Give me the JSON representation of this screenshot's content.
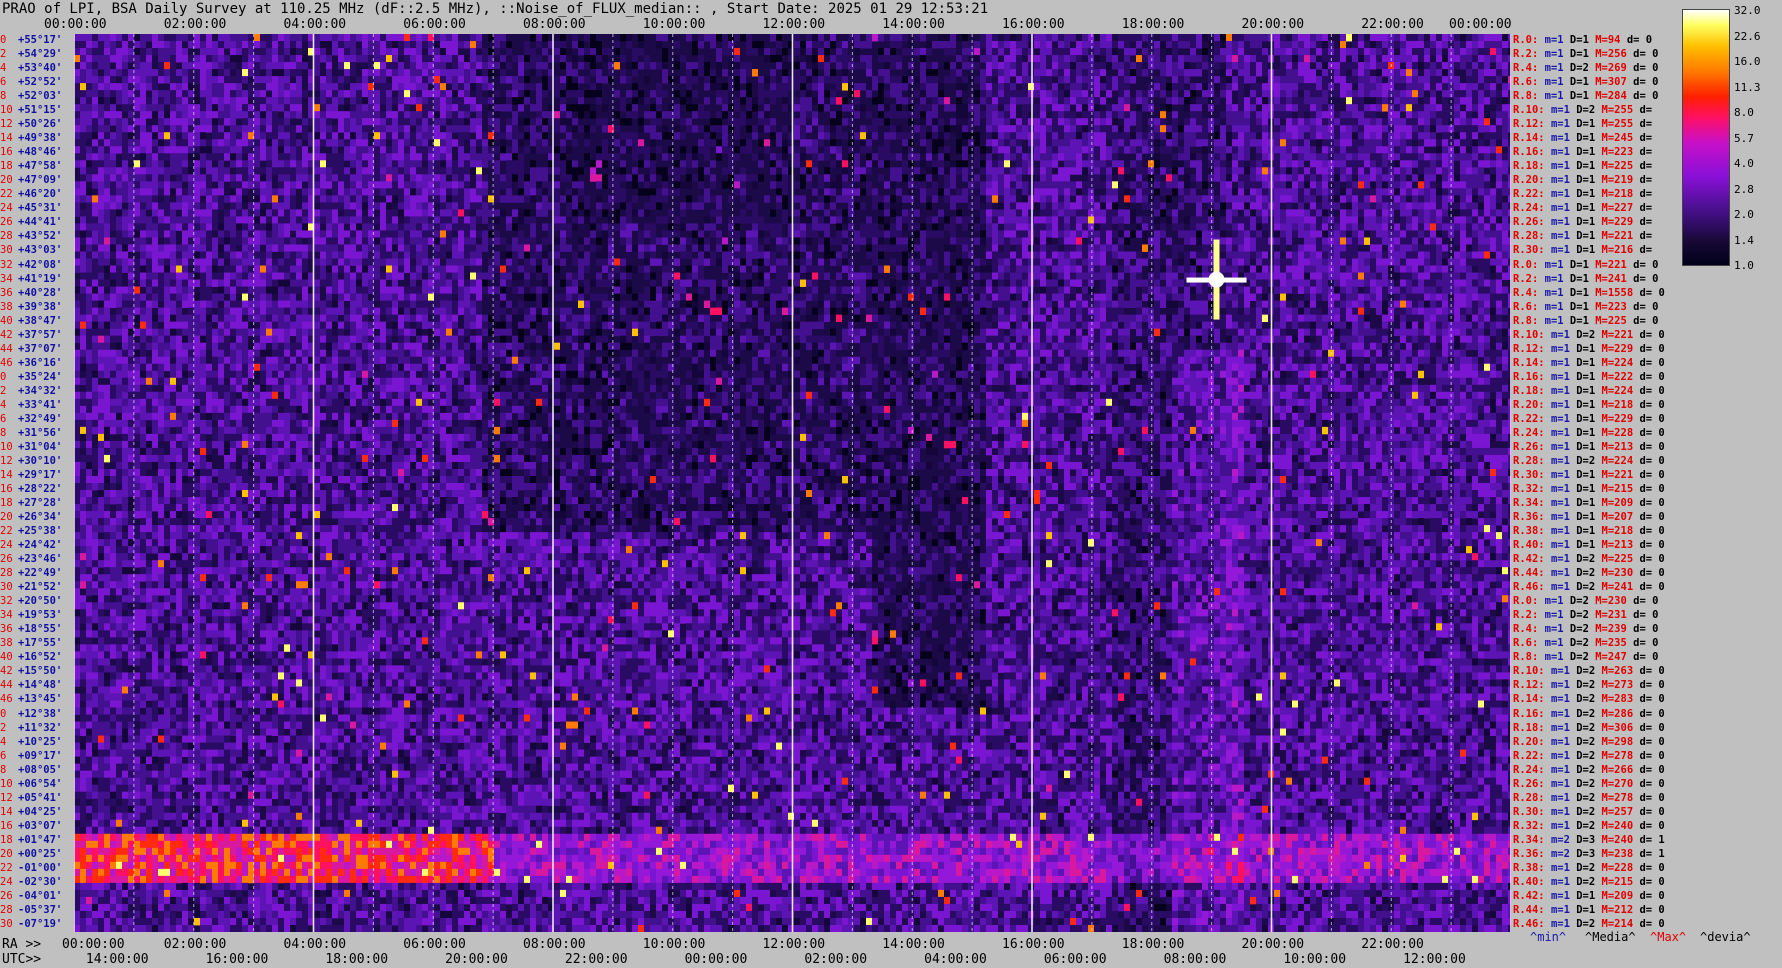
{
  "title": "PRAO of LPI, BSA Daily Survey at 110.25 MHz (dF::2.5 MHz), ::Noise_of_FLUX_median:: , Start Date: 2025 01 29 12:53:21",
  "top_axis": [
    "00:00:00",
    "02:00:00",
    "04:00:00",
    "06:00:00",
    "08:00:00",
    "10:00:00",
    "12:00:00",
    "14:00:00",
    "16:00:00",
    "18:00:00",
    "20:00:00",
    "22:00:00",
    "00:00:00"
  ],
  "ra_label": "RA >>",
  "ra_axis": [
    "00:00:00",
    "02:00:00",
    "04:00:00",
    "06:00:00",
    "08:00:00",
    "10:00:00",
    "12:00:00",
    "14:00:00",
    "16:00:00",
    "18:00:00",
    "20:00:00",
    "22:00:00"
  ],
  "utc_label": "UTC>>",
  "utc_axis": [
    "14:00:00",
    "16:00:00",
    "18:00:00",
    "20:00:00",
    "22:00:00",
    "00:00:00",
    "02:00:00",
    "04:00:00",
    "06:00:00",
    "08:00:00",
    "10:00:00",
    "12:00:00"
  ],
  "left_rows": [
    {
      "n": "0",
      "dec": "+55°17'"
    },
    {
      "n": "2",
      "dec": "+54°29'"
    },
    {
      "n": "4",
      "dec": "+53°40'"
    },
    {
      "n": "6",
      "dec": "+52°52'"
    },
    {
      "n": "8",
      "dec": "+52°03'"
    },
    {
      "n": "10",
      "dec": "+51°15'"
    },
    {
      "n": "12",
      "dec": "+50°26'"
    },
    {
      "n": "14",
      "dec": "+49°38'"
    },
    {
      "n": "16",
      "dec": "+48°46'"
    },
    {
      "n": "18",
      "dec": "+47°58'"
    },
    {
      "n": "20",
      "dec": "+47°09'"
    },
    {
      "n": "22",
      "dec": "+46°20'"
    },
    {
      "n": "24",
      "dec": "+45°31'"
    },
    {
      "n": "26",
      "dec": "+44°41'"
    },
    {
      "n": "28",
      "dec": "+43°52'"
    },
    {
      "n": "30",
      "dec": "+43°03'"
    },
    {
      "n": "32",
      "dec": "+42°08'"
    },
    {
      "n": "34",
      "dec": "+41°19'"
    },
    {
      "n": "36",
      "dec": "+40°28'"
    },
    {
      "n": "38",
      "dec": "+39°38'"
    },
    {
      "n": "40",
      "dec": "+38°47'"
    },
    {
      "n": "42",
      "dec": "+37°57'"
    },
    {
      "n": "44",
      "dec": "+37°07'"
    },
    {
      "n": "46",
      "dec": "+36°16'"
    },
    {
      "n": "0",
      "dec": "+35°24'"
    },
    {
      "n": "2",
      "dec": "+34°32'"
    },
    {
      "n": "4",
      "dec": "+33°41'"
    },
    {
      "n": "6",
      "dec": "+32°49'"
    },
    {
      "n": "8",
      "dec": "+31°56'"
    },
    {
      "n": "10",
      "dec": "+31°04'"
    },
    {
      "n": "12",
      "dec": "+30°10'"
    },
    {
      "n": "14",
      "dec": "+29°17'"
    },
    {
      "n": "16",
      "dec": "+28°22'"
    },
    {
      "n": "18",
      "dec": "+27°28'"
    },
    {
      "n": "20",
      "dec": "+26°34'"
    },
    {
      "n": "22",
      "dec": "+25°38'"
    },
    {
      "n": "24",
      "dec": "+24°42'"
    },
    {
      "n": "26",
      "dec": "+23°46'"
    },
    {
      "n": "28",
      "dec": "+22°49'"
    },
    {
      "n": "30",
      "dec": "+21°52'"
    },
    {
      "n": "32",
      "dec": "+20°50'"
    },
    {
      "n": "34",
      "dec": "+19°53'"
    },
    {
      "n": "36",
      "dec": "+18°55'"
    },
    {
      "n": "38",
      "dec": "+17°55'"
    },
    {
      "n": "40",
      "dec": "+16°52'"
    },
    {
      "n": "42",
      "dec": "+15°50'"
    },
    {
      "n": "44",
      "dec": "+14°48'"
    },
    {
      "n": "46",
      "dec": "+13°45'"
    },
    {
      "n": "0",
      "dec": "+12°38'"
    },
    {
      "n": "2",
      "dec": "+11°32'"
    },
    {
      "n": "4",
      "dec": "+10°25'"
    },
    {
      "n": "6",
      "dec": "+09°17'"
    },
    {
      "n": "8",
      "dec": "+08°05'"
    },
    {
      "n": "10",
      "dec": "+06°54'"
    },
    {
      "n": "12",
      "dec": "+05°41'"
    },
    {
      "n": "14",
      "dec": "+04°25'"
    },
    {
      "n": "16",
      "dec": "+03°07'"
    },
    {
      "n": "18",
      "dec": "+01°47'"
    },
    {
      "n": "20",
      "dec": "+00°25'"
    },
    {
      "n": "22",
      "dec": "-01°00'"
    },
    {
      "n": "24",
      "dec": "-02°30'"
    },
    {
      "n": "26",
      "dec": "-04°01'"
    },
    {
      "n": "28",
      "dec": "-05°37'"
    },
    {
      "n": "30",
      "dec": "-07°19'"
    }
  ],
  "right_rows": [
    {
      "r": "R.0:",
      "m": "m=1",
      "d": "D=1",
      "h": "M=94",
      "dv": "d= 0"
    },
    {
      "r": "R.2:",
      "m": "m=1",
      "d": "D=1",
      "h": "M=256",
      "dv": "d= 0"
    },
    {
      "r": "R.4:",
      "m": "m=1",
      "d": "D=2",
      "h": "M=269",
      "dv": "d= 0"
    },
    {
      "r": "R.6:",
      "m": "m=1",
      "d": "D=1",
      "h": "M=307",
      "dv": "d= 0"
    },
    {
      "r": "R.8:",
      "m": "m=1",
      "d": "D=1",
      "h": "M=284",
      "dv": "d= 0"
    },
    {
      "r": "R.10:",
      "m": "m=1",
      "d": "D=2",
      "h": "M=255",
      "dv": "d="
    },
    {
      "r": "R.12:",
      "m": "m=1",
      "d": "D=1",
      "h": "M=255",
      "dv": "d="
    },
    {
      "r": "R.14:",
      "m": "m=1",
      "d": "D=1",
      "h": "M=245",
      "dv": "d="
    },
    {
      "r": "R.16:",
      "m": "m=1",
      "d": "D=1",
      "h": "M=223",
      "dv": "d="
    },
    {
      "r": "R.18:",
      "m": "m=1",
      "d": "D=1",
      "h": "M=225",
      "dv": "d="
    },
    {
      "r": "R.20:",
      "m": "m=1",
      "d": "D=1",
      "h": "M=219",
      "dv": "d="
    },
    {
      "r": "R.22:",
      "m": "m=1",
      "d": "D=1",
      "h": "M=218",
      "dv": "d="
    },
    {
      "r": "R.24:",
      "m": "m=1",
      "d": "D=1",
      "h": "M=227",
      "dv": "d="
    },
    {
      "r": "R.26:",
      "m": "m=1",
      "d": "D=1",
      "h": "M=229",
      "dv": "d="
    },
    {
      "r": "R.28:",
      "m": "m=1",
      "d": "D=1",
      "h": "M=221",
      "dv": "d="
    },
    {
      "r": "R.30:",
      "m": "m=1",
      "d": "D=1",
      "h": "M=216",
      "dv": "d="
    },
    {
      "r": "R.0:",
      "m": "m=1",
      "d": "D=1",
      "h": "M=221",
      "dv": "d= 0"
    },
    {
      "r": "R.2:",
      "m": "m=1",
      "d": "D=1",
      "h": "M=241",
      "dv": "d= 0"
    },
    {
      "r": "R.4:",
      "m": "m=1",
      "d": "D=1",
      "h": "M=1558",
      "dv": "d= 0"
    },
    {
      "r": "R.6:",
      "m": "m=1",
      "d": "D=1",
      "h": "M=223",
      "dv": "d= 0"
    },
    {
      "r": "R.8:",
      "m": "m=1",
      "d": "D=1",
      "h": "M=225",
      "dv": "d= 0"
    },
    {
      "r": "R.10:",
      "m": "m=1",
      "d": "D=2",
      "h": "M=221",
      "dv": "d= 0"
    },
    {
      "r": "R.12:",
      "m": "m=1",
      "d": "D=1",
      "h": "M=229",
      "dv": "d= 0"
    },
    {
      "r": "R.14:",
      "m": "m=1",
      "d": "D=1",
      "h": "M=224",
      "dv": "d= 0"
    },
    {
      "r": "R.16:",
      "m": "m=1",
      "d": "D=1",
      "h": "M=222",
      "dv": "d= 0"
    },
    {
      "r": "R.18:",
      "m": "m=1",
      "d": "D=1",
      "h": "M=224",
      "dv": "d= 0"
    },
    {
      "r": "R.20:",
      "m": "m=1",
      "d": "D=1",
      "h": "M=218",
      "dv": "d= 0"
    },
    {
      "r": "R.22:",
      "m": "m=1",
      "d": "D=1",
      "h": "M=229",
      "dv": "d= 0"
    },
    {
      "r": "R.24:",
      "m": "m=1",
      "d": "D=1",
      "h": "M=228",
      "dv": "d= 0"
    },
    {
      "r": "R.26:",
      "m": "m=1",
      "d": "D=1",
      "h": "M=213",
      "dv": "d= 0"
    },
    {
      "r": "R.28:",
      "m": "m=1",
      "d": "D=2",
      "h": "M=224",
      "dv": "d= 0"
    },
    {
      "r": "R.30:",
      "m": "m=1",
      "d": "D=1",
      "h": "M=221",
      "dv": "d= 0"
    },
    {
      "r": "R.32:",
      "m": "m=1",
      "d": "D=1",
      "h": "M=215",
      "dv": "d= 0"
    },
    {
      "r": "R.34:",
      "m": "m=1",
      "d": "D=1",
      "h": "M=209",
      "dv": "d= 0"
    },
    {
      "r": "R.36:",
      "m": "m=1",
      "d": "D=1",
      "h": "M=207",
      "dv": "d= 0"
    },
    {
      "r": "R.38:",
      "m": "m=1",
      "d": "D=1",
      "h": "M=218",
      "dv": "d= 0"
    },
    {
      "r": "R.40:",
      "m": "m=1",
      "d": "D=1",
      "h": "M=213",
      "dv": "d= 0"
    },
    {
      "r": "R.42:",
      "m": "m=1",
      "d": "D=2",
      "h": "M=225",
      "dv": "d= 0"
    },
    {
      "r": "R.44:",
      "m": "m=1",
      "d": "D=2",
      "h": "M=230",
      "dv": "d= 0"
    },
    {
      "r": "R.46:",
      "m": "m=1",
      "d": "D=2",
      "h": "M=241",
      "dv": "d= 0"
    },
    {
      "r": "R.0:",
      "m": "m=1",
      "d": "D=2",
      "h": "M=230",
      "dv": "d= 0"
    },
    {
      "r": "R.2:",
      "m": "m=1",
      "d": "D=2",
      "h": "M=231",
      "dv": "d= 0"
    },
    {
      "r": "R.4:",
      "m": "m=1",
      "d": "D=2",
      "h": "M=239",
      "dv": "d= 0"
    },
    {
      "r": "R.6:",
      "m": "m=1",
      "d": "D=2",
      "h": "M=235",
      "dv": "d= 0"
    },
    {
      "r": "R.8:",
      "m": "m=1",
      "d": "D=2",
      "h": "M=247",
      "dv": "d= 0"
    },
    {
      "r": "R.10:",
      "m": "m=1",
      "d": "D=2",
      "h": "M=263",
      "dv": "d= 0"
    },
    {
      "r": "R.12:",
      "m": "m=1",
      "d": "D=2",
      "h": "M=273",
      "dv": "d= 0"
    },
    {
      "r": "R.14:",
      "m": "m=1",
      "d": "D=2",
      "h": "M=283",
      "dv": "d= 0"
    },
    {
      "r": "R.16:",
      "m": "m=1",
      "d": "D=2",
      "h": "M=286",
      "dv": "d= 0"
    },
    {
      "r": "R.18:",
      "m": "m=1",
      "d": "D=2",
      "h": "M=306",
      "dv": "d= 0"
    },
    {
      "r": "R.20:",
      "m": "m=1",
      "d": "D=2",
      "h": "M=298",
      "dv": "d= 0"
    },
    {
      "r": "R.22:",
      "m": "m=1",
      "d": "D=2",
      "h": "M=278",
      "dv": "d= 0"
    },
    {
      "r": "R.24:",
      "m": "m=1",
      "d": "D=2",
      "h": "M=266",
      "dv": "d= 0"
    },
    {
      "r": "R.26:",
      "m": "m=1",
      "d": "D=2",
      "h": "M=270",
      "dv": "d= 0"
    },
    {
      "r": "R.28:",
      "m": "m=1",
      "d": "D=2",
      "h": "M=278",
      "dv": "d= 0"
    },
    {
      "r": "R.30:",
      "m": "m=1",
      "d": "D=2",
      "h": "M=257",
      "dv": "d= 0"
    },
    {
      "r": "R.32:",
      "m": "m=1",
      "d": "D=2",
      "h": "M=240",
      "dv": "d= 0"
    },
    {
      "r": "R.34:",
      "m": "m=2",
      "d": "D=3",
      "h": "M=240",
      "dv": "d= 1"
    },
    {
      "r": "R.36:",
      "m": "m=2",
      "d": "D=3",
      "h": "M=238",
      "dv": "d= 1"
    },
    {
      "r": "R.38:",
      "m": "m=1",
      "d": "D=2",
      "h": "M=228",
      "dv": "d= 0"
    },
    {
      "r": "R.40:",
      "m": "m=1",
      "d": "D=2",
      "h": "M=215",
      "dv": "d= 0"
    },
    {
      "r": "R.42:",
      "m": "m=1",
      "d": "D=1",
      "h": "M=209",
      "dv": "d= 0"
    },
    {
      "r": "R.44:",
      "m": "m=1",
      "d": "D=1",
      "h": "M=212",
      "dv": "d= 0"
    },
    {
      "r": "R.46:",
      "m": "m=1",
      "d": "D=2",
      "h": "M=214",
      "dv": "d= 0"
    }
  ],
  "legend_bottom": {
    "min": "^min^",
    "media": "^Media^",
    "max": "^Max^",
    "devia": "^devia^"
  },
  "chart_data": {
    "type": "heatmap",
    "title": "PRAO of LPI, BSA Daily Survey at 110.25 MHz (dF::2.5 MHz), ::Noise_of_FLUX_median:: , Start Date: 2025 01 29 12:53:21",
    "x_ticks_top": [
      "00:00:00",
      "02:00:00",
      "04:00:00",
      "06:00:00",
      "08:00:00",
      "10:00:00",
      "12:00:00",
      "14:00:00",
      "16:00:00",
      "18:00:00",
      "20:00:00",
      "22:00:00",
      "00:00:00"
    ],
    "x_range_hours": [
      0,
      24
    ],
    "colorbar_ticks": [
      32.0,
      22.6,
      16.0,
      11.3,
      8.0,
      5.7,
      4.0,
      2.8,
      2.0,
      1.4,
      1.0
    ],
    "colorbar_scale": "log",
    "colormap": [
      "#000018",
      "#4a1090",
      "#8a10d8",
      "#c810c8",
      "#ff1060",
      "#ff2000",
      "#ff7a00",
      "#ffc000",
      "#ffff60",
      "#ffffff"
    ],
    "num_rows": 64,
    "features": [
      {
        "label": "bright source",
        "ra_hours": 20.0,
        "dec": "+40°28'"
      },
      {
        "label": "bright band",
        "dec_from": "+01°47'",
        "dec_to": "+00°25'",
        "ra_hours_from": 0,
        "ra_hours_to": 7.5
      }
    ]
  }
}
